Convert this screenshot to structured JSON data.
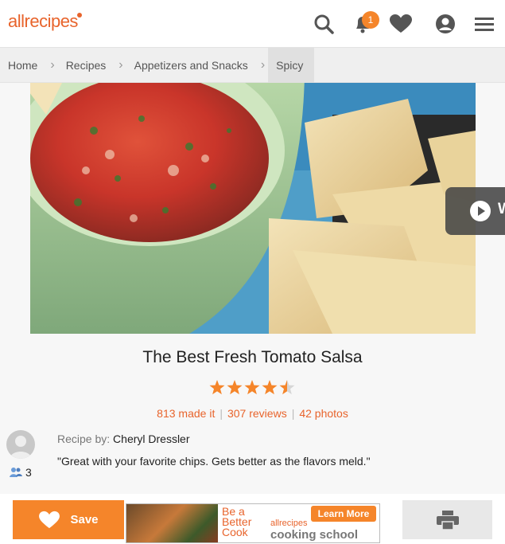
{
  "header": {
    "logo_text": "allrecipes",
    "notification_count": "1",
    "icons": [
      "search-icon",
      "bell-icon",
      "heart-icon",
      "user-icon",
      "menu-icon"
    ]
  },
  "breadcrumb": {
    "items": [
      "Home",
      "Recipes",
      "Appetizers and Snacks",
      "Spicy"
    ]
  },
  "video": {
    "label": "W"
  },
  "recipe": {
    "title": "The Best Fresh Tomato Salsa",
    "rating": 4.5,
    "made_it": "813 made it",
    "reviews": "307 reviews",
    "photos": "42 photos",
    "recipe_by_label": "Recipe by:",
    "author": "Cheryl Dressler",
    "quote": "\"Great with your favorite chips. Gets better as the flavors meld.\"",
    "followers": "3"
  },
  "bottom_bar": {
    "save_label": "Save",
    "ad": {
      "line1": "Be a",
      "line2": "Better",
      "line3": "Cook",
      "brand": "allrecipes",
      "cta": "Learn More",
      "tagline": "cooking school"
    }
  },
  "colors": {
    "accent": "#f5852a",
    "link": "#e8642c",
    "star": "#f5852a"
  }
}
